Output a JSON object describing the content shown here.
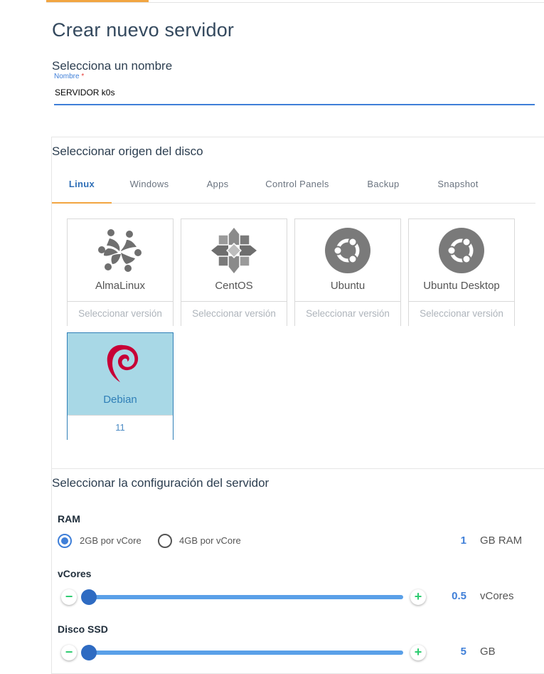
{
  "page": {
    "title": "Crear nuevo servidor"
  },
  "name_section": {
    "heading": "Selecciona un nombre",
    "field_label": "Nombre",
    "required_mark": "*",
    "value": "SERVIDOR k0s"
  },
  "disk_section": {
    "heading": "Seleccionar origen del disco",
    "tabs": [
      {
        "label": "Linux",
        "active": true
      },
      {
        "label": "Windows",
        "active": false
      },
      {
        "label": "Apps",
        "active": false
      },
      {
        "label": "Control Panels",
        "active": false
      },
      {
        "label": "Backup",
        "active": false
      },
      {
        "label": "Snapshot",
        "active": false
      }
    ],
    "os_cards": [
      {
        "name": "AlmaLinux",
        "version": "Seleccionar versión",
        "icon": "almalinux-logo-icon",
        "selected": false
      },
      {
        "name": "CentOS",
        "version": "Seleccionar versión",
        "icon": "centos-logo-icon",
        "selected": false
      },
      {
        "name": "Ubuntu",
        "version": "Seleccionar versión",
        "icon": "ubuntu-logo-icon",
        "selected": false
      },
      {
        "name": "Ubuntu Desktop",
        "version": "Seleccionar versión",
        "icon": "ubuntu-logo-icon",
        "selected": false
      },
      {
        "name": "Debian",
        "version": "11",
        "icon": "debian-logo-icon",
        "selected": true
      }
    ]
  },
  "config_section": {
    "heading": "Seleccionar la configuración del servidor",
    "ram": {
      "label": "RAM",
      "options": [
        {
          "label": "2GB por vCore",
          "checked": true
        },
        {
          "label": "4GB por vCore",
          "checked": false
        }
      ],
      "value": "1",
      "unit": "GB RAM"
    },
    "vcores": {
      "label": "vCores",
      "value": "0.5",
      "unit": "vCores",
      "slider_level": 0
    },
    "disk": {
      "label": "Disco SSD",
      "value": "5",
      "unit": "GB",
      "slider_level": 0
    },
    "minus_symbol": "−",
    "plus_symbol": "+"
  },
  "colors": {
    "accent_orange": "#f2a541",
    "primary_blue": "#3f7fd8",
    "selected_card_bg": "#a8d8e6",
    "plus_minus_green": "#2ecc71",
    "debian_red": "#c70036"
  }
}
